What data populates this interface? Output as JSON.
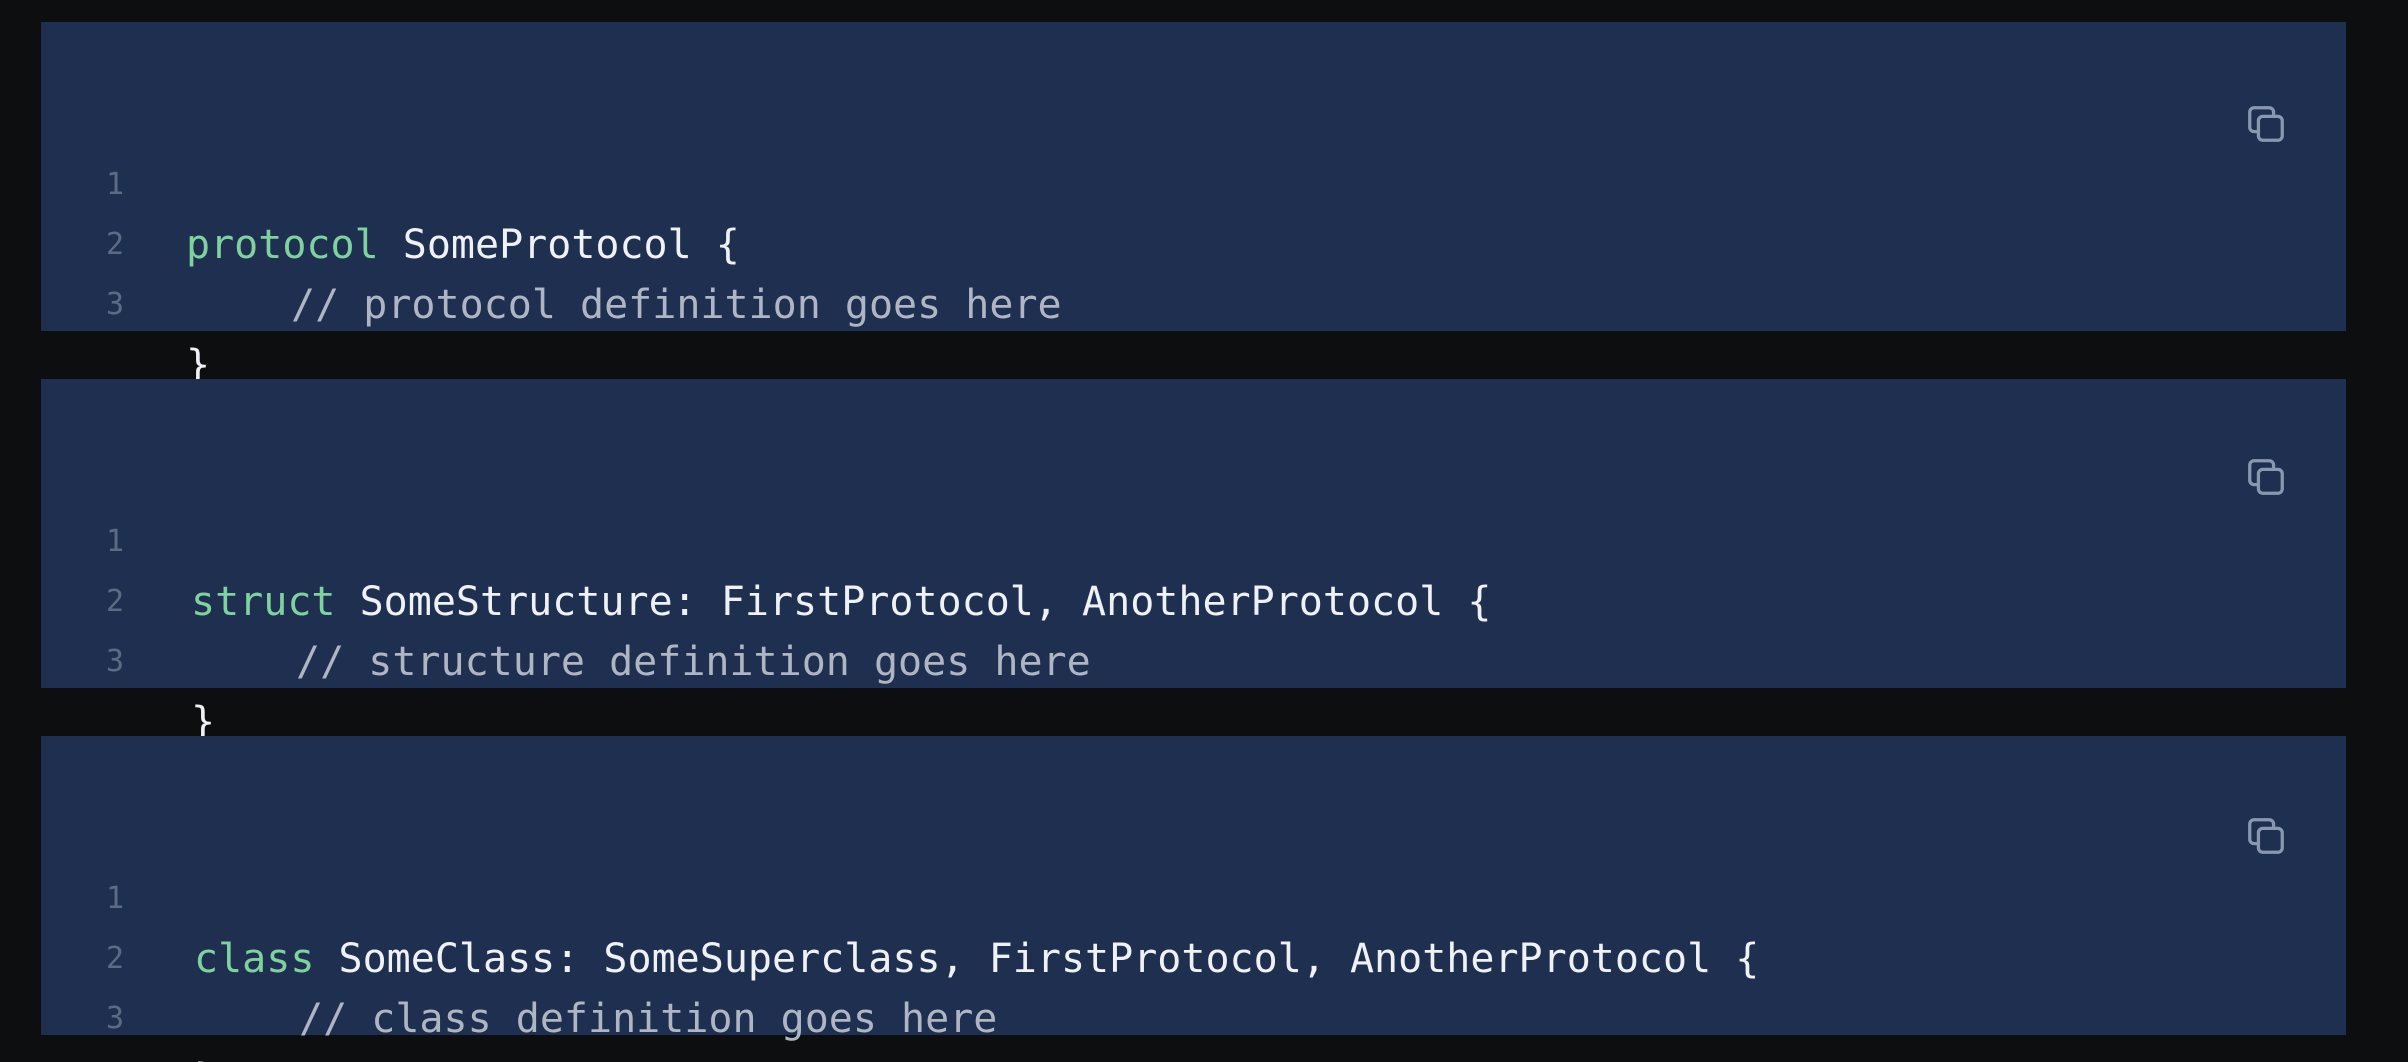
{
  "blocks": [
    {
      "lines": [
        {
          "num": "1",
          "keyword": "protocol",
          "rest": " SomeProtocol {"
        },
        {
          "num": "2",
          "comment": "// protocol definition goes here"
        },
        {
          "num": "3",
          "rest": "}"
        }
      ],
      "copy_icon": "copy-icon"
    },
    {
      "lines": [
        {
          "num": "1",
          "keyword": "struct",
          "rest": " SomeStructure: FirstProtocol, AnotherProtocol {"
        },
        {
          "num": "2",
          "comment": "// structure definition goes here"
        },
        {
          "num": "3",
          "rest": "}"
        }
      ],
      "copy_icon": "copy-icon"
    },
    {
      "lines": [
        {
          "num": "1",
          "keyword": "class",
          "rest": " SomeClass: SomeSuperclass, FirstProtocol, AnotherProtocol {"
        },
        {
          "num": "2",
          "comment": "// class definition goes here"
        },
        {
          "num": "3",
          "rest": "}"
        }
      ],
      "copy_icon": "copy-icon"
    }
  ],
  "colors": {
    "page_background": "#0d0e10",
    "block_background": "#1f2f50",
    "keyword": "#7fd2a0",
    "comment": "#aeb6c4",
    "text": "#eef1f5",
    "line_number": "#5d6a84",
    "icon": "#8a97b0"
  }
}
